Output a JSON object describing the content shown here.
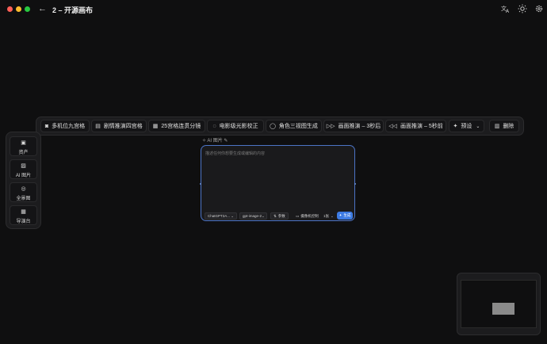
{
  "window": {
    "back_glyph": "←",
    "title": "2 – 开源画布"
  },
  "top_icons": {
    "translate": "translate-icon",
    "theme": "sun-icon",
    "settings": "gear-icon"
  },
  "toolbar": {
    "items": [
      {
        "label": "多机位九宫格",
        "icon": "camera-icon"
      },
      {
        "label": "剧情推演四宫格",
        "icon": "clapperboard-icon"
      },
      {
        "label": "25宫格连贯分镜",
        "icon": "film-icon"
      },
      {
        "label": "电影级光影校正",
        "icon": "lightbulb-icon"
      },
      {
        "label": "角色三视图生成",
        "icon": "person-icon"
      },
      {
        "label": "画面推演 – 3秒后",
        "icon": "fast-forward-icon"
      },
      {
        "label": "画面推演 – 5秒前",
        "icon": "rewind-icon"
      },
      {
        "label": "预设",
        "icon": "sparkle-icon"
      },
      {
        "label": "删除",
        "icon": "trash-icon"
      }
    ]
  },
  "sidebar": {
    "items": [
      {
        "label": "资产",
        "icon": "image-icon"
      },
      {
        "label": "AI 图片",
        "icon": "ai-image-icon"
      },
      {
        "label": "全景图",
        "icon": "globe-icon"
      },
      {
        "label": "导演台",
        "icon": "grid-icon"
      }
    ]
  },
  "node": {
    "header": "AI 图片",
    "placeholder": "描述任何你想要生成或编辑的内容",
    "model": "ChatGPT2A...",
    "image_model": "gpt-image-2",
    "params": "参数",
    "camera": "摄像机控制",
    "count": "1张",
    "generate": "生成"
  },
  "colors": {
    "accent": "#3d7be3",
    "node_border": "#4c74c6",
    "background": "#0f0f10"
  }
}
